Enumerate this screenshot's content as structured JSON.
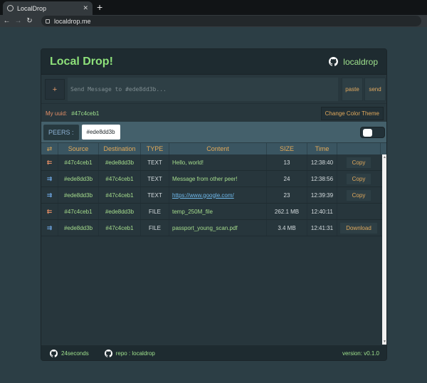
{
  "browser": {
    "tab_title": "LocalDrop",
    "url": "localdrop.me"
  },
  "header": {
    "title": "Local Drop!",
    "repo_link": "localdrop"
  },
  "composer": {
    "add_label": "+",
    "placeholder": "Send Message to #ede8dd3b...",
    "paste_label": "paste",
    "send_label": "send"
  },
  "identity": {
    "uuid_label": "My uuid:",
    "uuid_value": "#47c4ceb1",
    "theme_button": "Change Color Theme"
  },
  "peers": {
    "label": "PEERS :",
    "items": [
      "#ede8dd3b"
    ]
  },
  "table": {
    "headers": [
      "⇄",
      "Source",
      "Destination",
      "TYPE",
      "Content",
      "SIZE",
      "Time",
      ""
    ],
    "rows": [
      {
        "direction": "in",
        "arrow": "⇇",
        "source": "#47c4ceb1",
        "destination": "#ede8dd3b",
        "type": "TEXT",
        "content": "Hello, world!",
        "size": "13",
        "time": "12:38:40",
        "action": "Copy"
      },
      {
        "direction": "out",
        "arrow": "⇉",
        "source": "#ede8dd3b",
        "destination": "#47c4ceb1",
        "type": "TEXT",
        "content": "Message from other peer!",
        "size": "24",
        "time": "12:38:56",
        "action": "Copy"
      },
      {
        "direction": "out",
        "arrow": "⇉",
        "source": "#ede8dd3b",
        "destination": "#47c4ceb1",
        "type": "TEXT",
        "content": "https://www.google.com/",
        "size": "23",
        "time": "12:39:39",
        "action": "Copy"
      },
      {
        "direction": "in",
        "arrow": "⇇",
        "source": "#47c4ceb1",
        "destination": "#ede8dd3b",
        "type": "FILE",
        "content": "temp_250M_file",
        "size": "262.1 MB",
        "time": "12:40:11",
        "action": ""
      },
      {
        "direction": "out",
        "arrow": "⇉",
        "source": "#ede8dd3b",
        "destination": "#47c4ceb1",
        "type": "FILE",
        "content": "passport_young_scan.pdf",
        "size": "3.4 MB",
        "time": "12:41:31",
        "action": "Download"
      }
    ]
  },
  "footer": {
    "author": "24seconds",
    "repo": "repo : localdrop",
    "version": "version: v0.1.0"
  }
}
